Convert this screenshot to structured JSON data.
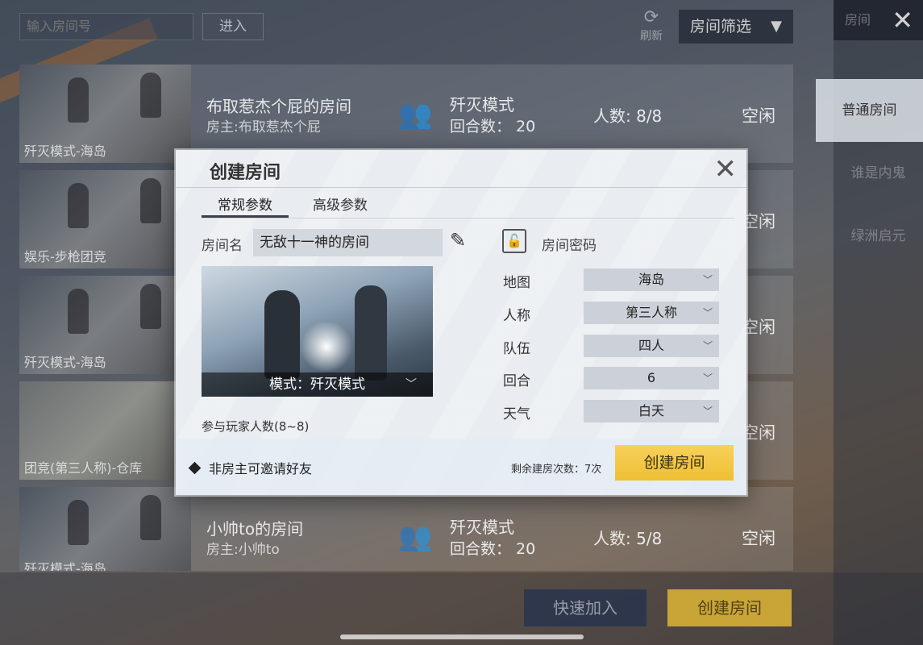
{
  "topbar": {
    "room_input_placeholder": "输入房间号",
    "enter_label": "进入",
    "refresh_label": "刷新",
    "filter_label": "房间筛选"
  },
  "side_panel": {
    "header": "房间",
    "tabs": [
      {
        "label": "普通房间",
        "active": true
      },
      {
        "label": "谁是内鬼",
        "active": false
      },
      {
        "label": "绿洲启元",
        "active": false
      }
    ]
  },
  "rooms": [
    {
      "thumb_label": "歼灭模式-海岛",
      "name": "布取惹杰个屁的房间",
      "owner": "房主:布取惹杰个屁",
      "mode": "歼灭模式",
      "rounds": "回合数： 20",
      "count": "人数: 8/8",
      "status": "空闲"
    },
    {
      "thumb_label": "娱乐-步枪团竞",
      "name": "",
      "owner": "",
      "mode": "",
      "rounds": "",
      "count": "",
      "status": "空闲"
    },
    {
      "thumb_label": "歼灭模式-海岛",
      "name": "",
      "owner": "",
      "mode": "",
      "rounds": "",
      "count": "",
      "status": "空闲"
    },
    {
      "thumb_label": "团竞(第三人称)-仓库",
      "name": "",
      "owner": "",
      "mode": "",
      "rounds": "",
      "count": "",
      "status": "空闲"
    },
    {
      "thumb_label": "歼灭模式-海岛",
      "name": "小帅to的房间",
      "owner": "房主:小帅to",
      "mode": "歼灭模式",
      "rounds": "回合数： 20",
      "count": "人数: 5/8",
      "status": "空闲"
    }
  ],
  "bottom": {
    "quick_join": "快速加入",
    "create_room": "创建房间"
  },
  "dialog": {
    "title": "创建房间",
    "tabs": [
      "常规参数",
      "高级参数"
    ],
    "room_name_label": "房间名",
    "room_name_value": "无敌十一神的房间",
    "password_label": "房间密码",
    "mode_label": "模式：歼灭模式",
    "players_label": "参与玩家人数(8~8)",
    "options": [
      {
        "label": "地图",
        "value": "海岛"
      },
      {
        "label": "人称",
        "value": "第三人称"
      },
      {
        "label": "队伍",
        "value": "四人"
      },
      {
        "label": "回合",
        "value": "6"
      },
      {
        "label": "天气",
        "value": "白天"
      }
    ],
    "invite_label": "非房主可邀请好友",
    "remaining_label": "剩余建房次数：7次",
    "create_label": "创建房间"
  }
}
